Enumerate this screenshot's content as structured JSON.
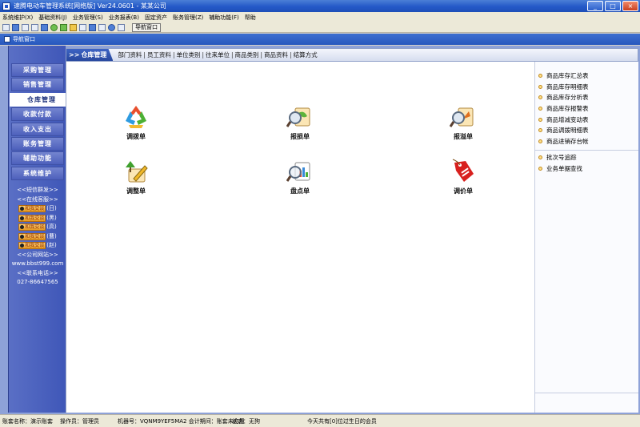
{
  "window": {
    "title": "速腾电动车管理系统[网络版] Ver24.0601 - 某某公司",
    "min": "_",
    "max": "□",
    "close": "×"
  },
  "menubar": [
    "系统维护(X)",
    "基础资料(J)",
    "业务管理(S)",
    "业务报表(B)",
    "固定资产",
    "账务管理(Z)",
    "辅助功能(F)",
    "帮助"
  ],
  "toolbar": {
    "nav_button": "导航窗口"
  },
  "tab": {
    "label": "导航窗口"
  },
  "category": {
    "head": "仓库管理",
    "arrow": ">>",
    "links": [
      "部门资料",
      "员工资料",
      "单位类别",
      "往来单位",
      "商品类别",
      "商品资料",
      "结算方式"
    ]
  },
  "sidebar": {
    "items": [
      "采购管理",
      "销售管理",
      "仓库管理",
      "收款付款",
      "收入支出",
      "账务管理",
      "辅助功能",
      "系统维护"
    ],
    "active": "仓库管理",
    "sms": "<<短信群发>>",
    "online": "<<在线客服>>",
    "qq": [
      {
        "btn": "和我交谈",
        "tag": "(日)"
      },
      {
        "btn": "和我交谈",
        "tag": "(黑)"
      },
      {
        "btn": "和我交谈",
        "tag": "(高)"
      },
      {
        "btn": "和我交谈",
        "tag": "(曹)"
      },
      {
        "btn": "和我交谈",
        "tag": "(赵)"
      }
    ],
    "website_label": "<<公司网站>>",
    "website": "www.bbst999.com",
    "phone_label": "<<联系电话>>",
    "phone": "027-86647565"
  },
  "tiles": [
    {
      "label": "调拨单",
      "icon": "recycle-arrows-icon"
    },
    {
      "label": "报损单",
      "icon": "magnifier-leaf-icon"
    },
    {
      "label": "报溢单",
      "icon": "magnifier-arrow-icon"
    },
    {
      "label": "调整单",
      "icon": "pencil-tree-icon"
    },
    {
      "label": "盘点单",
      "icon": "magnifier-chart-icon"
    },
    {
      "label": "调价单",
      "icon": "price-tag-icon"
    }
  ],
  "reports": [
    "商品库存汇总表",
    "商品库存明细表",
    "商品库存分析表",
    "商品库存报警表",
    "商品增减变动表",
    "商品调拨明细表",
    "商品进销存台帐"
  ],
  "reports2": [
    "批次号追踪",
    "业务单据查找"
  ],
  "status": {
    "account": "账套名称：演示账套",
    "operator": "操作员：管理员",
    "machine": "机器号：VQNM9YEF5MA2 会计期间：账套未启用",
    "state": "状态：无狗",
    "birthday": "今天共有[0]位过生日的会员"
  },
  "colors": {
    "title": "#2459c8",
    "sidebar": "#4a5fbf",
    "workarea": "#8ea2d8"
  }
}
